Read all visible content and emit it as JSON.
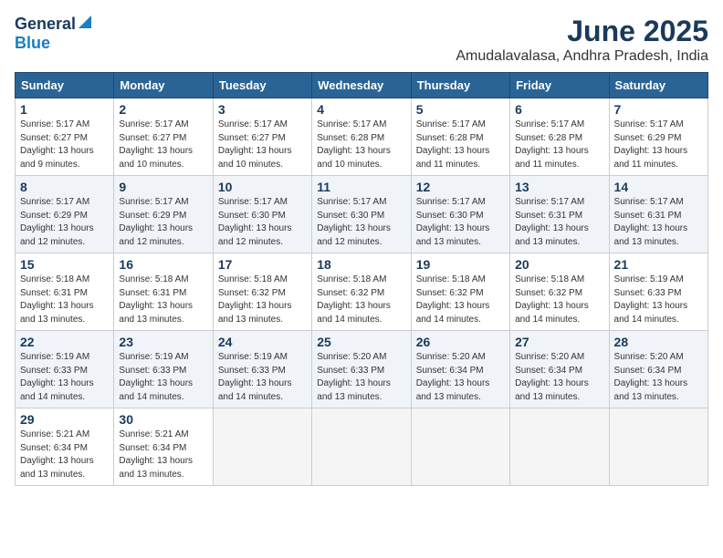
{
  "logo": {
    "general": "General",
    "blue": "Blue"
  },
  "title": "June 2025",
  "location": "Amudalavalasa, Andhra Pradesh, India",
  "weekdays": [
    "Sunday",
    "Monday",
    "Tuesday",
    "Wednesday",
    "Thursday",
    "Friday",
    "Saturday"
  ],
  "weeks": [
    [
      {
        "day": 1,
        "sunrise": "5:17 AM",
        "sunset": "6:27 PM",
        "daylight": "13 hours and 9 minutes."
      },
      {
        "day": 2,
        "sunrise": "5:17 AM",
        "sunset": "6:27 PM",
        "daylight": "13 hours and 10 minutes."
      },
      {
        "day": 3,
        "sunrise": "5:17 AM",
        "sunset": "6:27 PM",
        "daylight": "13 hours and 10 minutes."
      },
      {
        "day": 4,
        "sunrise": "5:17 AM",
        "sunset": "6:28 PM",
        "daylight": "13 hours and 10 minutes."
      },
      {
        "day": 5,
        "sunrise": "5:17 AM",
        "sunset": "6:28 PM",
        "daylight": "13 hours and 11 minutes."
      },
      {
        "day": 6,
        "sunrise": "5:17 AM",
        "sunset": "6:28 PM",
        "daylight": "13 hours and 11 minutes."
      },
      {
        "day": 7,
        "sunrise": "5:17 AM",
        "sunset": "6:29 PM",
        "daylight": "13 hours and 11 minutes."
      }
    ],
    [
      {
        "day": 8,
        "sunrise": "5:17 AM",
        "sunset": "6:29 PM",
        "daylight": "13 hours and 12 minutes."
      },
      {
        "day": 9,
        "sunrise": "5:17 AM",
        "sunset": "6:29 PM",
        "daylight": "13 hours and 12 minutes."
      },
      {
        "day": 10,
        "sunrise": "5:17 AM",
        "sunset": "6:30 PM",
        "daylight": "13 hours and 12 minutes."
      },
      {
        "day": 11,
        "sunrise": "5:17 AM",
        "sunset": "6:30 PM",
        "daylight": "13 hours and 12 minutes."
      },
      {
        "day": 12,
        "sunrise": "5:17 AM",
        "sunset": "6:30 PM",
        "daylight": "13 hours and 13 minutes."
      },
      {
        "day": 13,
        "sunrise": "5:17 AM",
        "sunset": "6:31 PM",
        "daylight": "13 hours and 13 minutes."
      },
      {
        "day": 14,
        "sunrise": "5:17 AM",
        "sunset": "6:31 PM",
        "daylight": "13 hours and 13 minutes."
      }
    ],
    [
      {
        "day": 15,
        "sunrise": "5:18 AM",
        "sunset": "6:31 PM",
        "daylight": "13 hours and 13 minutes."
      },
      {
        "day": 16,
        "sunrise": "5:18 AM",
        "sunset": "6:31 PM",
        "daylight": "13 hours and 13 minutes."
      },
      {
        "day": 17,
        "sunrise": "5:18 AM",
        "sunset": "6:32 PM",
        "daylight": "13 hours and 13 minutes."
      },
      {
        "day": 18,
        "sunrise": "5:18 AM",
        "sunset": "6:32 PM",
        "daylight": "13 hours and 14 minutes."
      },
      {
        "day": 19,
        "sunrise": "5:18 AM",
        "sunset": "6:32 PM",
        "daylight": "13 hours and 14 minutes."
      },
      {
        "day": 20,
        "sunrise": "5:18 AM",
        "sunset": "6:32 PM",
        "daylight": "13 hours and 14 minutes."
      },
      {
        "day": 21,
        "sunrise": "5:19 AM",
        "sunset": "6:33 PM",
        "daylight": "13 hours and 14 minutes."
      }
    ],
    [
      {
        "day": 22,
        "sunrise": "5:19 AM",
        "sunset": "6:33 PM",
        "daylight": "13 hours and 14 minutes."
      },
      {
        "day": 23,
        "sunrise": "5:19 AM",
        "sunset": "6:33 PM",
        "daylight": "13 hours and 14 minutes."
      },
      {
        "day": 24,
        "sunrise": "5:19 AM",
        "sunset": "6:33 PM",
        "daylight": "13 hours and 14 minutes."
      },
      {
        "day": 25,
        "sunrise": "5:20 AM",
        "sunset": "6:33 PM",
        "daylight": "13 hours and 13 minutes."
      },
      {
        "day": 26,
        "sunrise": "5:20 AM",
        "sunset": "6:34 PM",
        "daylight": "13 hours and 13 minutes."
      },
      {
        "day": 27,
        "sunrise": "5:20 AM",
        "sunset": "6:34 PM",
        "daylight": "13 hours and 13 minutes."
      },
      {
        "day": 28,
        "sunrise": "5:20 AM",
        "sunset": "6:34 PM",
        "daylight": "13 hours and 13 minutes."
      }
    ],
    [
      {
        "day": 29,
        "sunrise": "5:21 AM",
        "sunset": "6:34 PM",
        "daylight": "13 hours and 13 minutes."
      },
      {
        "day": 30,
        "sunrise": "5:21 AM",
        "sunset": "6:34 PM",
        "daylight": "13 hours and 13 minutes."
      },
      null,
      null,
      null,
      null,
      null
    ]
  ]
}
